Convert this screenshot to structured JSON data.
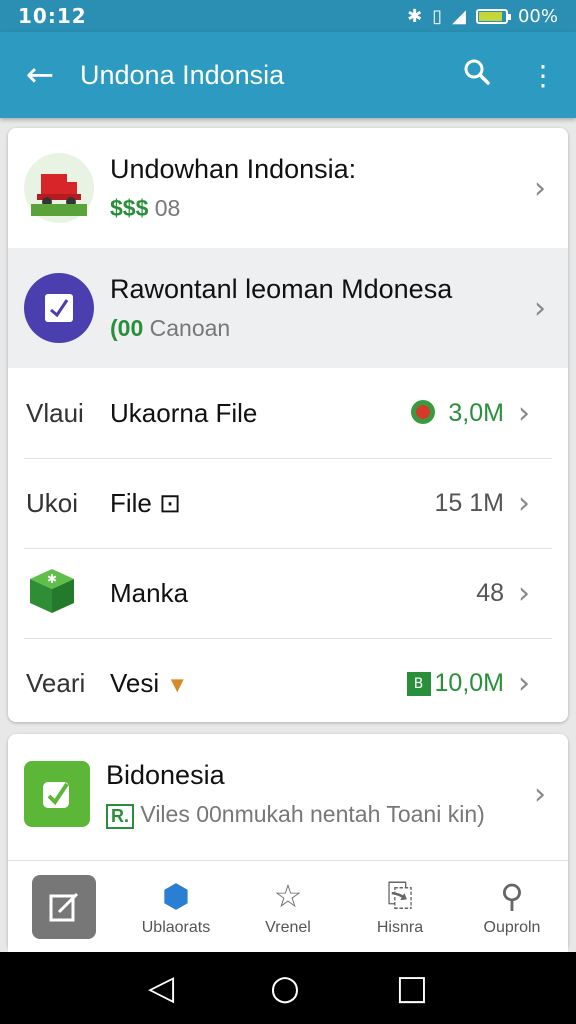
{
  "status": {
    "time": "10:12",
    "battery_text": "00%",
    "battery_level": 0.9,
    "icons": [
      "bluetooth-icon",
      "vibrate-icon",
      "signal-icon",
      "battery-icon"
    ]
  },
  "app_bar": {
    "title": "Undona Indonsia",
    "back_icon": "back-arrow-icon",
    "search_icon": "search-icon",
    "menu_icon": "more-vert-icon"
  },
  "featured": [
    {
      "title": "Undowhan Indonsia:",
      "badge": "$$$",
      "sub": "08",
      "icon": "truck-avatar-icon"
    },
    {
      "title": "Rawontanl leoman Mdonesa",
      "badge": "(00",
      "sub": "Canoan",
      "icon": "checkbox-avatar-icon"
    }
  ],
  "files": [
    {
      "lead": "Vlaui",
      "name": "Ukaorna File",
      "size": "3,0M",
      "size_green": true,
      "icon": "fruit-icon"
    },
    {
      "lead": "Ukoi",
      "name": "File ⊡",
      "size": "15 1M",
      "size_green": false,
      "icon": ""
    },
    {
      "lead": "",
      "name": "Manka",
      "size": "48",
      "size_green": false,
      "icon": "green-box-icon"
    },
    {
      "lead": "Veari",
      "name": "Vesi",
      "size": "10,0M",
      "size_green": true,
      "icon": "file-badge-icon"
    }
  ],
  "card2": {
    "title": "Bidonesia",
    "badge": "R.",
    "sub": "Viles 00nmukah nentah Toani kin)",
    "icon": "edit-square-icon"
  },
  "nav": [
    {
      "label": "",
      "icon": "edit-app-icon"
    },
    {
      "label": "Ublaorats",
      "icon": "grid-icon"
    },
    {
      "label": "Vrenel",
      "icon": "star-icon"
    },
    {
      "label": "Hisnra",
      "icon": "document-icon"
    },
    {
      "label": "Ouproln",
      "icon": "stamp-icon"
    }
  ],
  "colors": {
    "primary": "#2d9bc1",
    "green": "#2a8f3a"
  }
}
